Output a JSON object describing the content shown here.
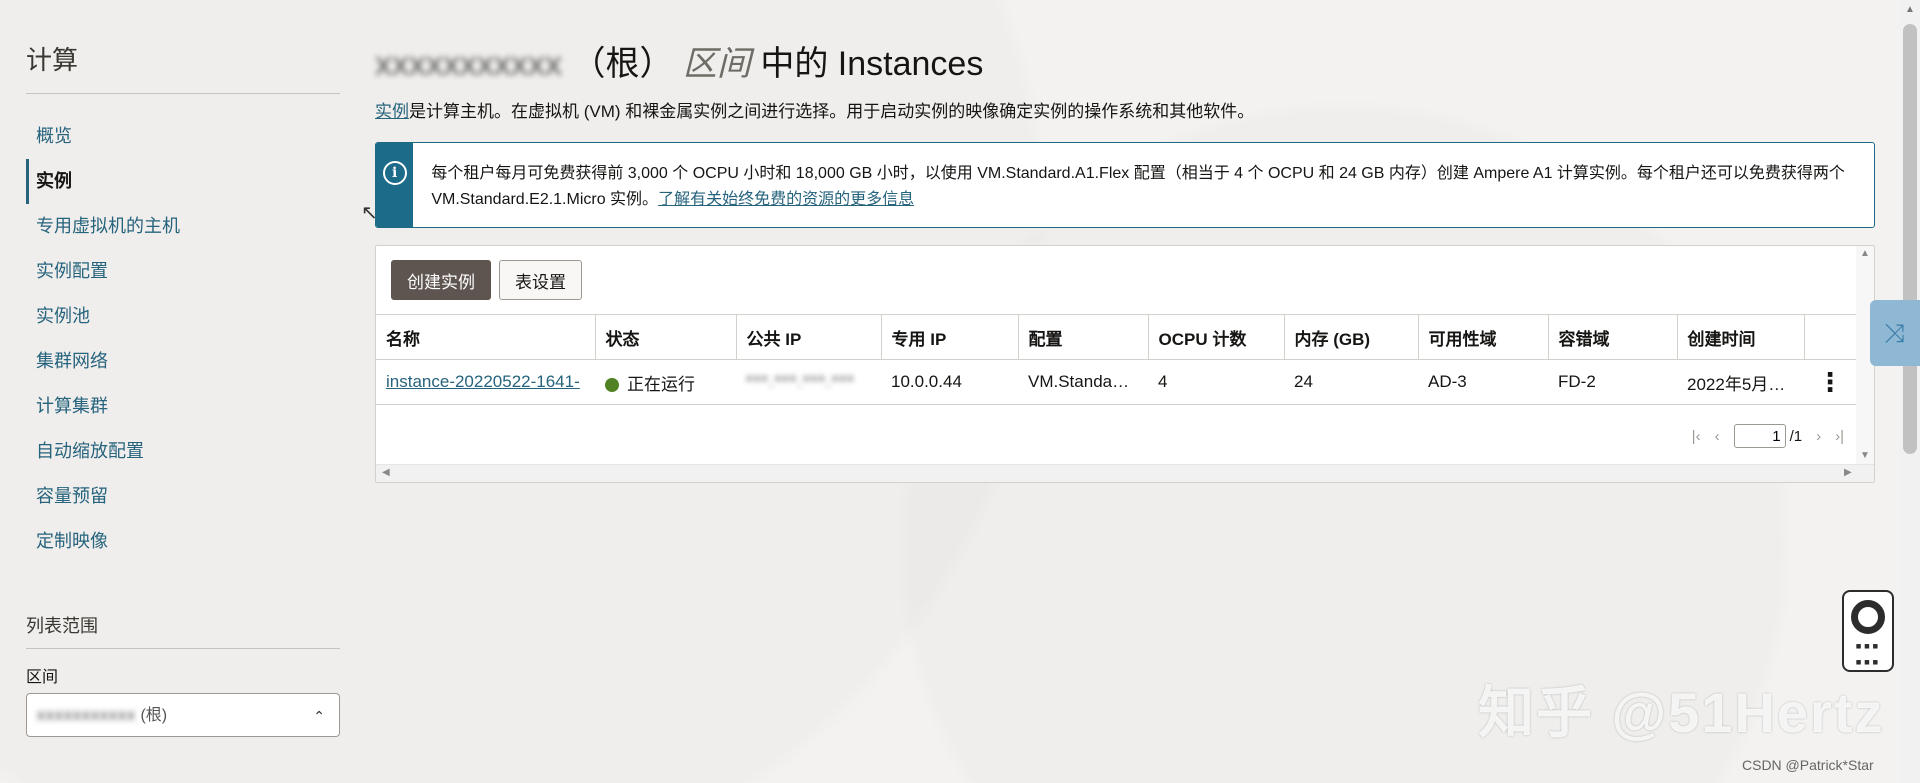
{
  "sidebar": {
    "title": "计算",
    "items": [
      {
        "label": "概览",
        "active": false
      },
      {
        "label": "实例",
        "active": true
      },
      {
        "label": "专用虚拟机的主机",
        "active": false
      },
      {
        "label": "实例配置",
        "active": false
      },
      {
        "label": "实例池",
        "active": false
      },
      {
        "label": "集群网络",
        "active": false
      },
      {
        "label": "计算集群",
        "active": false
      },
      {
        "label": "自动缩放配置",
        "active": false
      },
      {
        "label": "容量预留",
        "active": false
      },
      {
        "label": "定制映像",
        "active": false
      }
    ],
    "scope": {
      "title": "列表范围",
      "compartment_label": "区间",
      "compartment_value": "(根)"
    }
  },
  "header": {
    "title_prefix": "（根）",
    "title_qualifier": "区间",
    "title_suffix": "中的 Instances",
    "intro_link": "实例",
    "intro_text": "是计算主机。在虚拟机 (VM) 和裸金属实例之间进行选择。用于启动实例的映像确定实例的操作系统和其他软件。"
  },
  "banner": {
    "icon": "info-icon",
    "text": "每个租户每月可免费获得前 3,000 个 OCPU 小时和 18,000 GB 小时，以使用 VM.Standard.A1.Flex 配置（相当于 4 个 OCPU 和 24 GB 内存）创建 Ampere A1 计算实例。每个租户还可以免费获得两个 VM.Standard.E2.1.Micro 实例。",
    "link": "了解有关始终免费的资源的更多信息"
  },
  "toolbar": {
    "create_label": "创建实例",
    "settings_label": "表设置"
  },
  "table": {
    "columns": [
      "名称",
      "状态",
      "公共 IP",
      "专用 IP",
      "配置",
      "OCPU 计数",
      "内存 (GB)",
      "可用性域",
      "容错域",
      "创建时间"
    ],
    "rows": [
      {
        "name": "instance-20220522-1641-",
        "status": "正在运行",
        "public_ip": "***.***.***.***",
        "private_ip": "10.0.0.44",
        "shape": "VM.Standa…",
        "ocpu": "4",
        "memory": "24",
        "ad": "AD-3",
        "fd": "FD-2",
        "created": "2022年5月…"
      }
    ]
  },
  "pagination": {
    "page": "1",
    "total": "/1"
  },
  "watermark": "知乎 @51Hertz",
  "credit": "CSDN @Patrick*Star",
  "colors": {
    "accent": "#26637d",
    "banner": "#1c6b88",
    "primary_button": "#5f5550",
    "running": "#508223"
  }
}
